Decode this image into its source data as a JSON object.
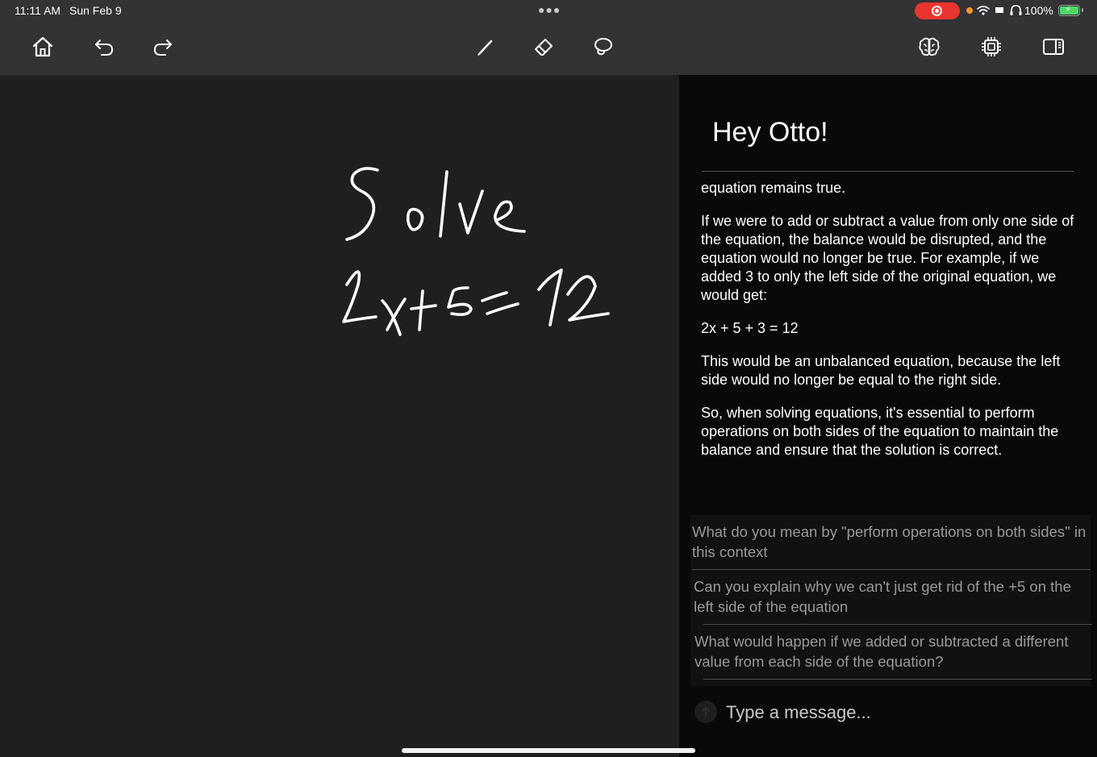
{
  "status_bar": {
    "time": "11:11 AM",
    "date": "Sun Feb 9",
    "battery": "100%",
    "recording_color": "#e8352f",
    "battery_fill_color": "#4bd964"
  },
  "toolbar": {
    "left_icons": [
      "home-icon",
      "undo-icon",
      "redo-icon"
    ],
    "center_icons": [
      "pen-icon",
      "eraser-icon",
      "lasso-icon"
    ],
    "right_icons": [
      "brain-icon",
      "chip-icon",
      "sidebar-icon"
    ]
  },
  "canvas": {
    "line1": "Solve",
    "line2": "2x+5=12",
    "ink_color": "#ffffff"
  },
  "panel": {
    "greeting": "Hey Otto!",
    "response": [
      "equation remains true.",
      "If we were to add or subtract a value from only one side of the equation, the balance would be disrupted, and the equation would no longer be true. For example, if we added 3 to only the left side of the original equation, we would get:",
      "2x + 5 + 3 = 12",
      "This would be an unbalanced equation, because the left side would no longer be equal to the right side.",
      "So, when solving equations, it's essential to perform operations on both sides of the equation to maintain the balance and ensure that the solution is correct."
    ],
    "suggestions": [
      "What do you mean by \"perform operations on both sides\" in this context",
      "Can you explain why we can't just get rid of the +5 on the left side of the equation",
      "What would happen if we added or subtracted a different value from each side of the equation?"
    ],
    "message_placeholder": "Type a message..."
  }
}
